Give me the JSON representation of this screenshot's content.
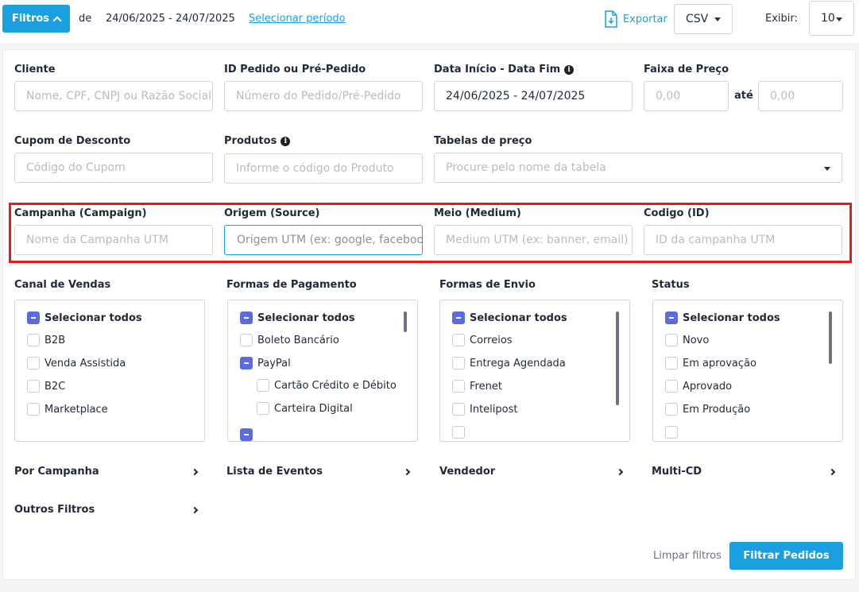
{
  "top": {
    "filtros_label": "Filtros",
    "de_label": "de",
    "period": "24/06/2025 - 24/07/2025",
    "select_period": "Selecionar período",
    "export_label": "Exportar",
    "format_value": "CSV",
    "exibir_label": "Exibir:",
    "page_size_value": "10"
  },
  "fields": {
    "cliente": {
      "label": "Cliente",
      "placeholder": "Nome, CPF, CNPJ ou Razão Social"
    },
    "pedido": {
      "label": "ID Pedido ou Pré-Pedido",
      "placeholder": "Número do Pedido/Pré-Pedido"
    },
    "data": {
      "label": "Data Início - Data Fim",
      "value": "24/06/2025 - 24/07/2025"
    },
    "preco": {
      "label": "Faixa de Preço",
      "min_placeholder": "0,00",
      "ate": "até",
      "max_placeholder": "0,00"
    },
    "cupom": {
      "label": "Cupom de Desconto",
      "placeholder": "Código do Cupom"
    },
    "produtos": {
      "label": "Produtos",
      "placeholder": "Informe o código do Produto"
    },
    "tabelas": {
      "label": "Tabelas de preço",
      "placeholder": "Procure pelo nome da tabela"
    },
    "campanha": {
      "label": "Campanha (Campaign)",
      "placeholder": "Nome da Campanha UTM"
    },
    "origem": {
      "label": "Origem (Source)",
      "placeholder": "Origem UTM (ex: google, facebook)"
    },
    "meio": {
      "label": "Meio (Medium)",
      "placeholder": "Medium UTM (ex: banner, email)"
    },
    "codigo": {
      "label": "Codigo (ID)",
      "placeholder": "ID da campanha UTM"
    }
  },
  "lists": {
    "canal": {
      "title": "Canal de Vendas",
      "select_all": "Selecionar todos",
      "items": [
        "B2B",
        "Venda Assistida",
        "B2C",
        "Marketplace"
      ]
    },
    "pagamento": {
      "title": "Formas de Pagamento",
      "select_all": "Selecionar todos",
      "items": [
        "Boleto Bancário",
        "PayPal",
        "Cartão Crédito e Débito",
        "Carteira Digital"
      ]
    },
    "envio": {
      "title": "Formas de Envio",
      "select_all": "Selecionar todos",
      "items": [
        "Correios",
        "Entrega Agendada",
        "Frenet",
        "Intelipost"
      ]
    },
    "status": {
      "title": "Status",
      "select_all": "Selecionar todos",
      "items": [
        "Novo",
        "Em aprovação",
        "Aprovado",
        "Em Produção"
      ]
    }
  },
  "collapsibles": {
    "por_campanha": "Por Campanha",
    "lista_eventos": "Lista de Eventos",
    "vendedor": "Vendedor",
    "multi_cd": "Multi-CD",
    "outros": "Outros Filtros"
  },
  "actions": {
    "clear": "Limpar filtros",
    "submit": "Filtrar Pedidos"
  },
  "colors": {
    "primary": "#1a9fe0",
    "checkbox": "#5b6be0",
    "highlight": "#e41c1c"
  }
}
